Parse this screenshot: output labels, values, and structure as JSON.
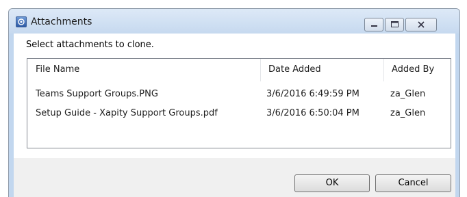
{
  "window": {
    "title": "Attachments",
    "icon": "attachments-app-icon",
    "controls": {
      "minimize_icon": "minimize-icon",
      "maximize_icon": "maximize-icon",
      "close_icon": "close-icon"
    }
  },
  "instruction": "Select attachments to clone.",
  "table": {
    "columns": [
      "File Name",
      "Date Added",
      "Added By"
    ],
    "rows": [
      [
        "Teams Support Groups.PNG",
        "3/6/2016 6:49:59 PM",
        "za_Glen"
      ],
      [
        "Setup Guide - Xapity Support Groups.pdf",
        "3/6/2016 6:50:04 PM",
        "za_Glen"
      ]
    ]
  },
  "buttons": {
    "ok": "OK",
    "cancel": "Cancel"
  },
  "colors": {
    "frame": "#c2d7ef",
    "client": "#ffffff",
    "footer": "#f0f0f0"
  }
}
